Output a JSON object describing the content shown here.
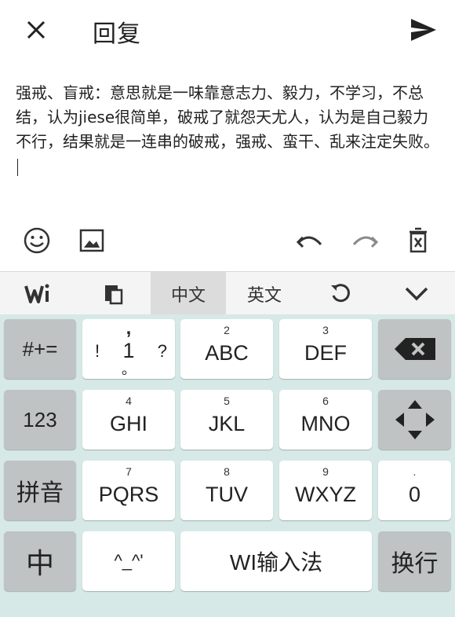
{
  "header": {
    "title": "回复"
  },
  "editor": {
    "text": "强戒、盲戒：意思就是一味靠意志力、毅力，不学习，不总结，认为jiese很简单，破戒了就怨天尤人，认为是自己毅力不行，结果就是一连串的破戒，强戒、蛮干、乱来注定失败。"
  },
  "toolbar": {
    "left_icons": [
      "emoji-icon",
      "image-icon"
    ],
    "right_icons": [
      "undo-icon",
      "redo-icon",
      "delete-icon"
    ]
  },
  "keyboard": {
    "bar": {
      "chinese": "中文",
      "english": "英文"
    },
    "row1": {
      "symbols": "#+=",
      "k1_top": ",",
      "k1_left": "!",
      "k1_main": "1",
      "k1_right": "?",
      "k1_bottom": "。",
      "k2_num": "2",
      "k2": "ABC",
      "k3_num": "3",
      "k3": "DEF"
    },
    "row2": {
      "numeric": "123",
      "k4_num": "4",
      "k4": "GHI",
      "k5_num": "5",
      "k5": "JKL",
      "k6_num": "6",
      "k6": "MNO"
    },
    "row3": {
      "pinyin": "拼音",
      "k7_num": "7",
      "k7": "PQRS",
      "k8_num": "8",
      "k8": "TUV",
      "k9_num": "9",
      "k9": "WXYZ",
      "k0_dot": ".",
      "k0": "0"
    },
    "row4": {
      "zh": "中",
      "face": "^_^'",
      "space": "WI输入法",
      "enter": "换行"
    }
  }
}
